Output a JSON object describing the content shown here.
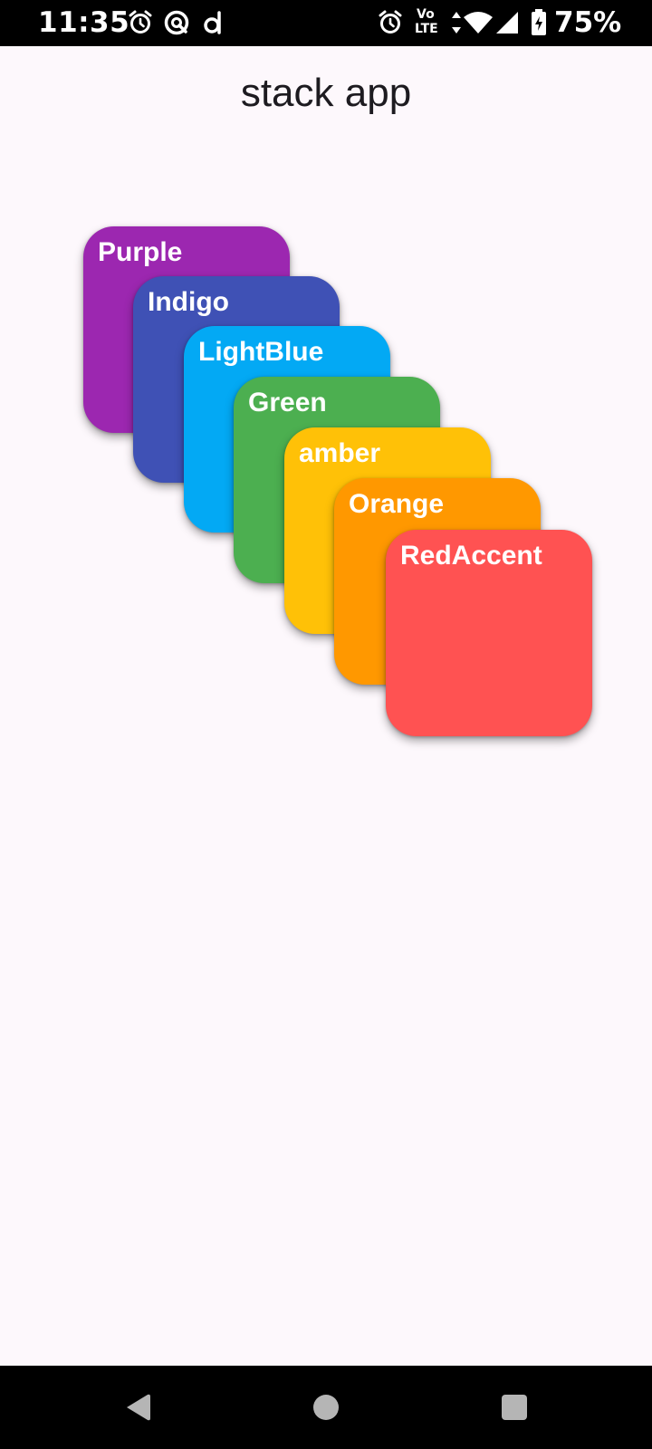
{
  "status_bar": {
    "time": "11:35",
    "battery_percent": "75%",
    "network_label_top": "Vo",
    "network_label_bottom": "LTE"
  },
  "app_bar": {
    "title": "stack app"
  },
  "cards": [
    {
      "label": "Purple",
      "color": "#9c27b0"
    },
    {
      "label": "Indigo",
      "color": "#3f51b5"
    },
    {
      "label": "LightBlue",
      "color": "#03a9f4"
    },
    {
      "label": "Green",
      "color": "#4caf50"
    },
    {
      "label": "amber",
      "color": "#ffc107"
    },
    {
      "label": "Orange",
      "color": "#ff9800"
    },
    {
      "label": "RedAccent",
      "color": "#ff5252"
    }
  ],
  "nav_bar": {
    "back_icon": "back-triangle-icon",
    "home_icon": "home-circle-icon",
    "recents_icon": "recents-square-icon"
  }
}
